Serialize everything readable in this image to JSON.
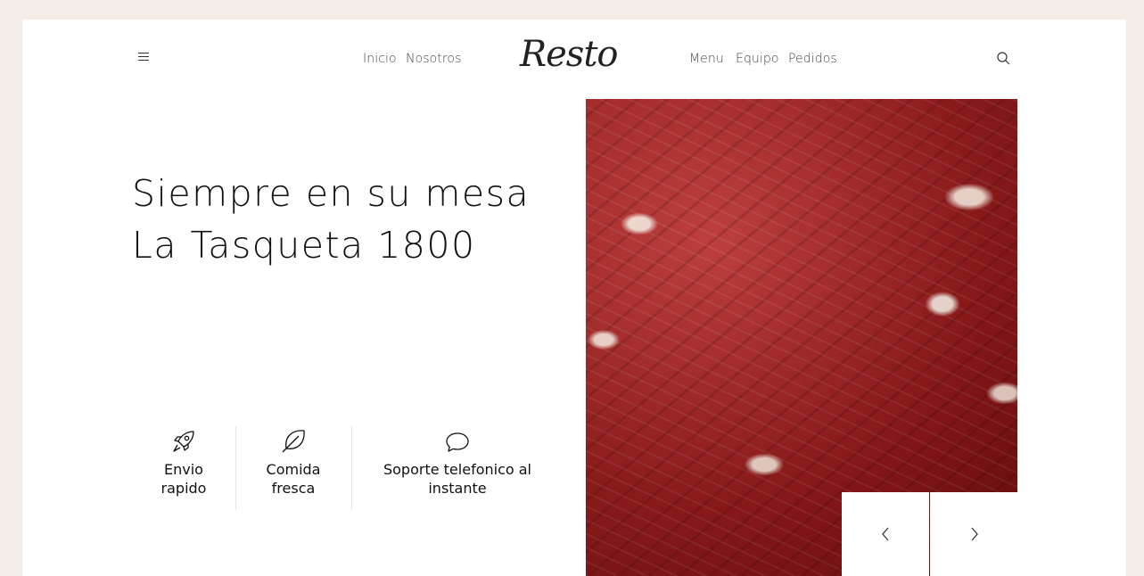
{
  "header": {
    "menu_icon": "hamburger-icon",
    "nav_left": [
      "Inicio",
      "Nosotros"
    ],
    "logo": "Resto",
    "nav_right": [
      "Menu",
      "Equipo",
      "Pedidos"
    ],
    "search_icon": "search-icon"
  },
  "hero": {
    "title_line1": "Siempre en su mesa",
    "title_line2": "La Tasqueta 1800"
  },
  "features": [
    {
      "icon": "rocket-icon",
      "line1": "Envio",
      "line2": "rapido"
    },
    {
      "icon": "leaf-icon",
      "line1": "Comida",
      "line2": "fresca"
    },
    {
      "icon": "chat-bubble-icon",
      "line1": "Soporte telefonico al",
      "line2": "instante"
    }
  ],
  "slider": {
    "image": "cured-ham-slices",
    "prev_icon": "chevron-left-icon",
    "next_icon": "chevron-right-icon"
  },
  "colors": {
    "page_background": "#f4ece6",
    "card_background": "#ffffff",
    "text": "#111111"
  }
}
